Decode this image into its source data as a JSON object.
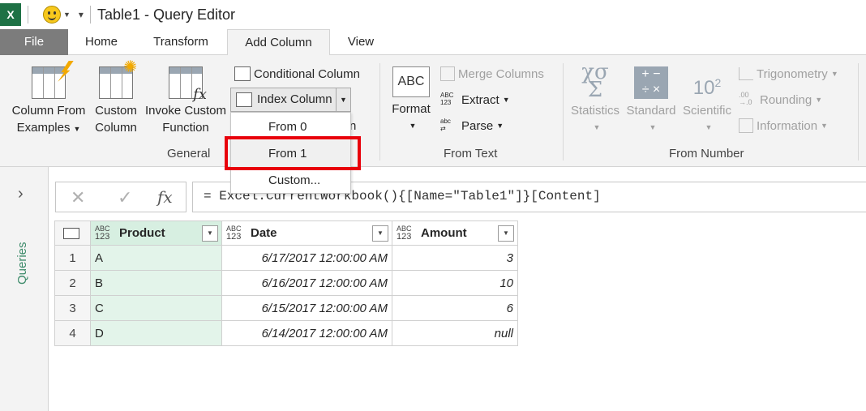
{
  "window": {
    "title": "Table1 - Query Editor",
    "app_icon_label": "X"
  },
  "tabs": [
    {
      "label": "File"
    },
    {
      "label": "Home"
    },
    {
      "label": "Transform"
    },
    {
      "label": "Add Column"
    },
    {
      "label": "View"
    }
  ],
  "ribbon": {
    "general": {
      "group_label": "General",
      "column_from_examples": [
        "Column From",
        "Examples"
      ],
      "custom_column": [
        "Custom",
        "Column"
      ],
      "invoke_custom_function": [
        "Invoke Custom",
        "Function"
      ],
      "conditional_column": "Conditional Column",
      "index_column": "Index Column",
      "duplicate_column_partial": "n"
    },
    "from_text": {
      "group_label": "From Text",
      "format": "Format",
      "merge_columns": "Merge Columns",
      "extract": "Extract",
      "parse": "Parse"
    },
    "from_number": {
      "group_label": "From Number",
      "statistics": "Statistics",
      "standard": "Standard",
      "scientific": "Scientific",
      "trigonometry": "Trigonometry",
      "rounding": "Rounding",
      "information": "Information"
    }
  },
  "index_menu": {
    "items": [
      "From 0",
      "From 1",
      "Custom..."
    ],
    "highlighted": "From 1"
  },
  "left_pane": {
    "label": "Queries"
  },
  "formula_bar": {
    "fx": "fx",
    "formula": "= Excel.CurrentWorkbook(){[Name=\"Table1\"]}[Content]"
  },
  "grid": {
    "columns": [
      {
        "name": "Product",
        "type_top": "ABC",
        "type_bottom": "123"
      },
      {
        "name": "Date",
        "type_top": "ABC",
        "type_bottom": "123"
      },
      {
        "name": "Amount",
        "type_top": "ABC",
        "type_bottom": "123"
      }
    ],
    "rows": [
      {
        "n": "1",
        "product": "A",
        "date": "6/17/2017 12:00:00 AM",
        "amount": "3"
      },
      {
        "n": "2",
        "product": "B",
        "date": "6/16/2017 12:00:00 AM",
        "amount": "10"
      },
      {
        "n": "3",
        "product": "C",
        "date": "6/15/2017 12:00:00 AM",
        "amount": "6"
      },
      {
        "n": "4",
        "product": "D",
        "date": "6/14/2017 12:00:00 AM",
        "amount": "null"
      }
    ]
  },
  "colors": {
    "accent_green": "#1e7145",
    "highlight_red": "#e8000b",
    "selected_column": "#e3f4ea"
  }
}
